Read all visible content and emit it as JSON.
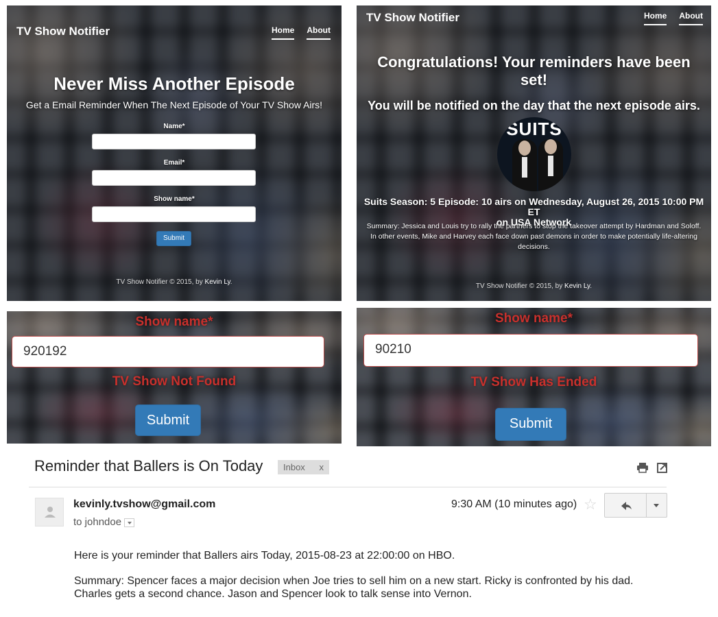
{
  "app_title": "TV Show Notifier",
  "nav": {
    "home": "Home",
    "about": "About"
  },
  "form_page": {
    "heading": "Never Miss Another Episode",
    "subheading": "Get a Email Reminder When The Next Episode of Your TV Show Airs!",
    "name_label": "Name*",
    "email_label": "Email*",
    "show_label": "Show name*",
    "submit": "Submit",
    "footer_prefix": "TV Show Notifier © 2015, by",
    "footer_author": "Kevin Ly",
    "footer_suffix": "."
  },
  "success_page": {
    "line1": "Congratulations! Your reminders have been",
    "line2": "set!",
    "line3": "You will be notified on the day that the next episode airs.",
    "poster_logo": "SUITS",
    "episode_line1": "Suits Season: 5 Episode: 10 airs on Wednesday, August 26, 2015 10:00 PM ET",
    "episode_line2": "on USA Network",
    "summary_line1": "Summary: Jessica and Louis try to rally the partners to stop the takeover attempt by Hardman and Soloff.",
    "summary_line2": "In other events, Mike and Harvey each face down past demons in order to make potentially life-altering",
    "summary_line3": "decisions.",
    "footer_prefix": "TV Show Notifier © 2015, by",
    "footer_author": "Kevin Ly",
    "footer_suffix": "."
  },
  "error_not_found": {
    "label": "Show name*",
    "value": "920192",
    "message": "TV Show Not Found",
    "submit": "Submit"
  },
  "error_ended": {
    "label": "Show name*",
    "value": "90210",
    "message": "TV Show Has Ended",
    "submit": "Submit"
  },
  "email": {
    "subject": "Reminder that Ballers is On Today",
    "label_tag": "Inbox",
    "label_close": "x",
    "from": "kevinly.tvshow@gmail.com",
    "to": "to johndoe",
    "time": "9:30 AM (10 minutes ago)",
    "body_line1": "Here is your reminder that Ballers airs Today, 2015-08-23 at 22:00:00 on HBO.",
    "body_line2": "Summary: Spencer faces a major decision when Joe tries to sell him on a new start. Ricky is confronted by his dad. Charles gets a second chance. Jason and Spencer look to talk sense into Vernon.",
    "icons": [
      "print-icon",
      "new-window-icon",
      "star-icon",
      "reply-icon",
      "more-options-icon",
      "avatar-icon"
    ]
  },
  "colors": {
    "primary_button": "#337ab7",
    "error_red": "#c9302c",
    "error_border": "#b94a48"
  }
}
